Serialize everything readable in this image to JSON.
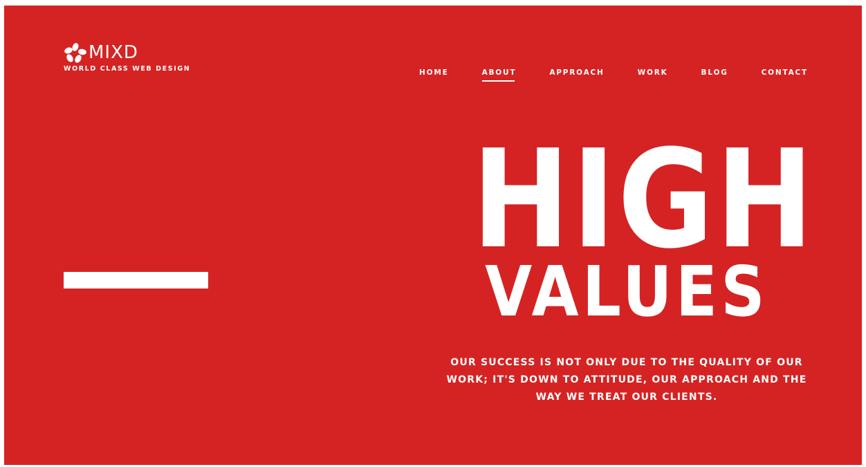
{
  "brand": {
    "name": "MIXD",
    "tagline": "WORLD CLASS WEB DESIGN",
    "logo_icon": "mixd-flower-icon"
  },
  "nav": {
    "items": [
      {
        "label": "HOME",
        "active": false
      },
      {
        "label": "ABOUT",
        "active": true
      },
      {
        "label": "APPROACH",
        "active": false
      },
      {
        "label": "WORK",
        "active": false
      },
      {
        "label": "BLOG",
        "active": false
      },
      {
        "label": "CONTACT",
        "active": false
      }
    ]
  },
  "hero": {
    "line1": "HIGH",
    "line2": "VALUES",
    "body": "OUR SUCCESS IS NOT ONLY DUE TO THE QUALITY OF OUR WORK; IT'S DOWN TO ATTITUDE, OUR APPROACH AND THE WAY WE TREAT OUR CLIENTS."
  },
  "colors": {
    "background": "#d52323",
    "foreground": "#ffffff"
  }
}
